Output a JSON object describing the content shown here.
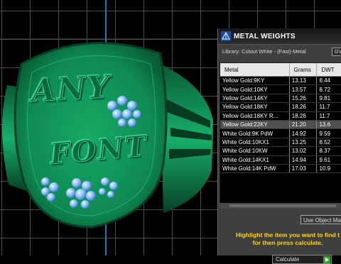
{
  "ring": {
    "engraving_line1": "ANY",
    "engraving_line2": "FONT"
  },
  "panel": {
    "title": "METAL WEIGHTS",
    "library_label": "Library: Cutout White - (Fast)-Metal",
    "library_button": "GV",
    "columns": [
      "Metal",
      "Grams",
      "DWT"
    ],
    "rows": [
      [
        "Yellow Gold:9KY",
        "13.13",
        "8.44"
      ],
      [
        "Yellow Gold:10KY",
        "13.57",
        "8.72"
      ],
      [
        "Yellow Gold:14KY",
        "15.26",
        "9.81"
      ],
      [
        "Yellow Gold:18KY",
        "18.26",
        "11.7"
      ],
      [
        "Yellow Gold:18KY R...",
        "18.26",
        "11.7"
      ],
      [
        "Yellow Gold:22KY",
        "21.20",
        "13.6"
      ],
      [
        "White Gold:9K PdW",
        "14.92",
        "9.59"
      ],
      [
        "White Gold:10KX1",
        "13.25",
        "8.52"
      ],
      [
        "White Gold:10KW",
        "13.02",
        "8.37"
      ],
      [
        "White Gold:14KX1",
        "14.94",
        "9.61"
      ],
      [
        "White Gold:14K PdW",
        "17.03",
        "10.9"
      ]
    ],
    "selected_row": 5,
    "use_object_button": "Use Object Ma",
    "hint_line1": "Highlight the item you want to find t",
    "hint_line2": "for then press calculate.",
    "calculate_label": "Calculate"
  },
  "colors": {
    "ring": "#0e8a52",
    "axis": "#1f7fb8",
    "hint": "#ffd21c",
    "go": "#2fa82f"
  }
}
